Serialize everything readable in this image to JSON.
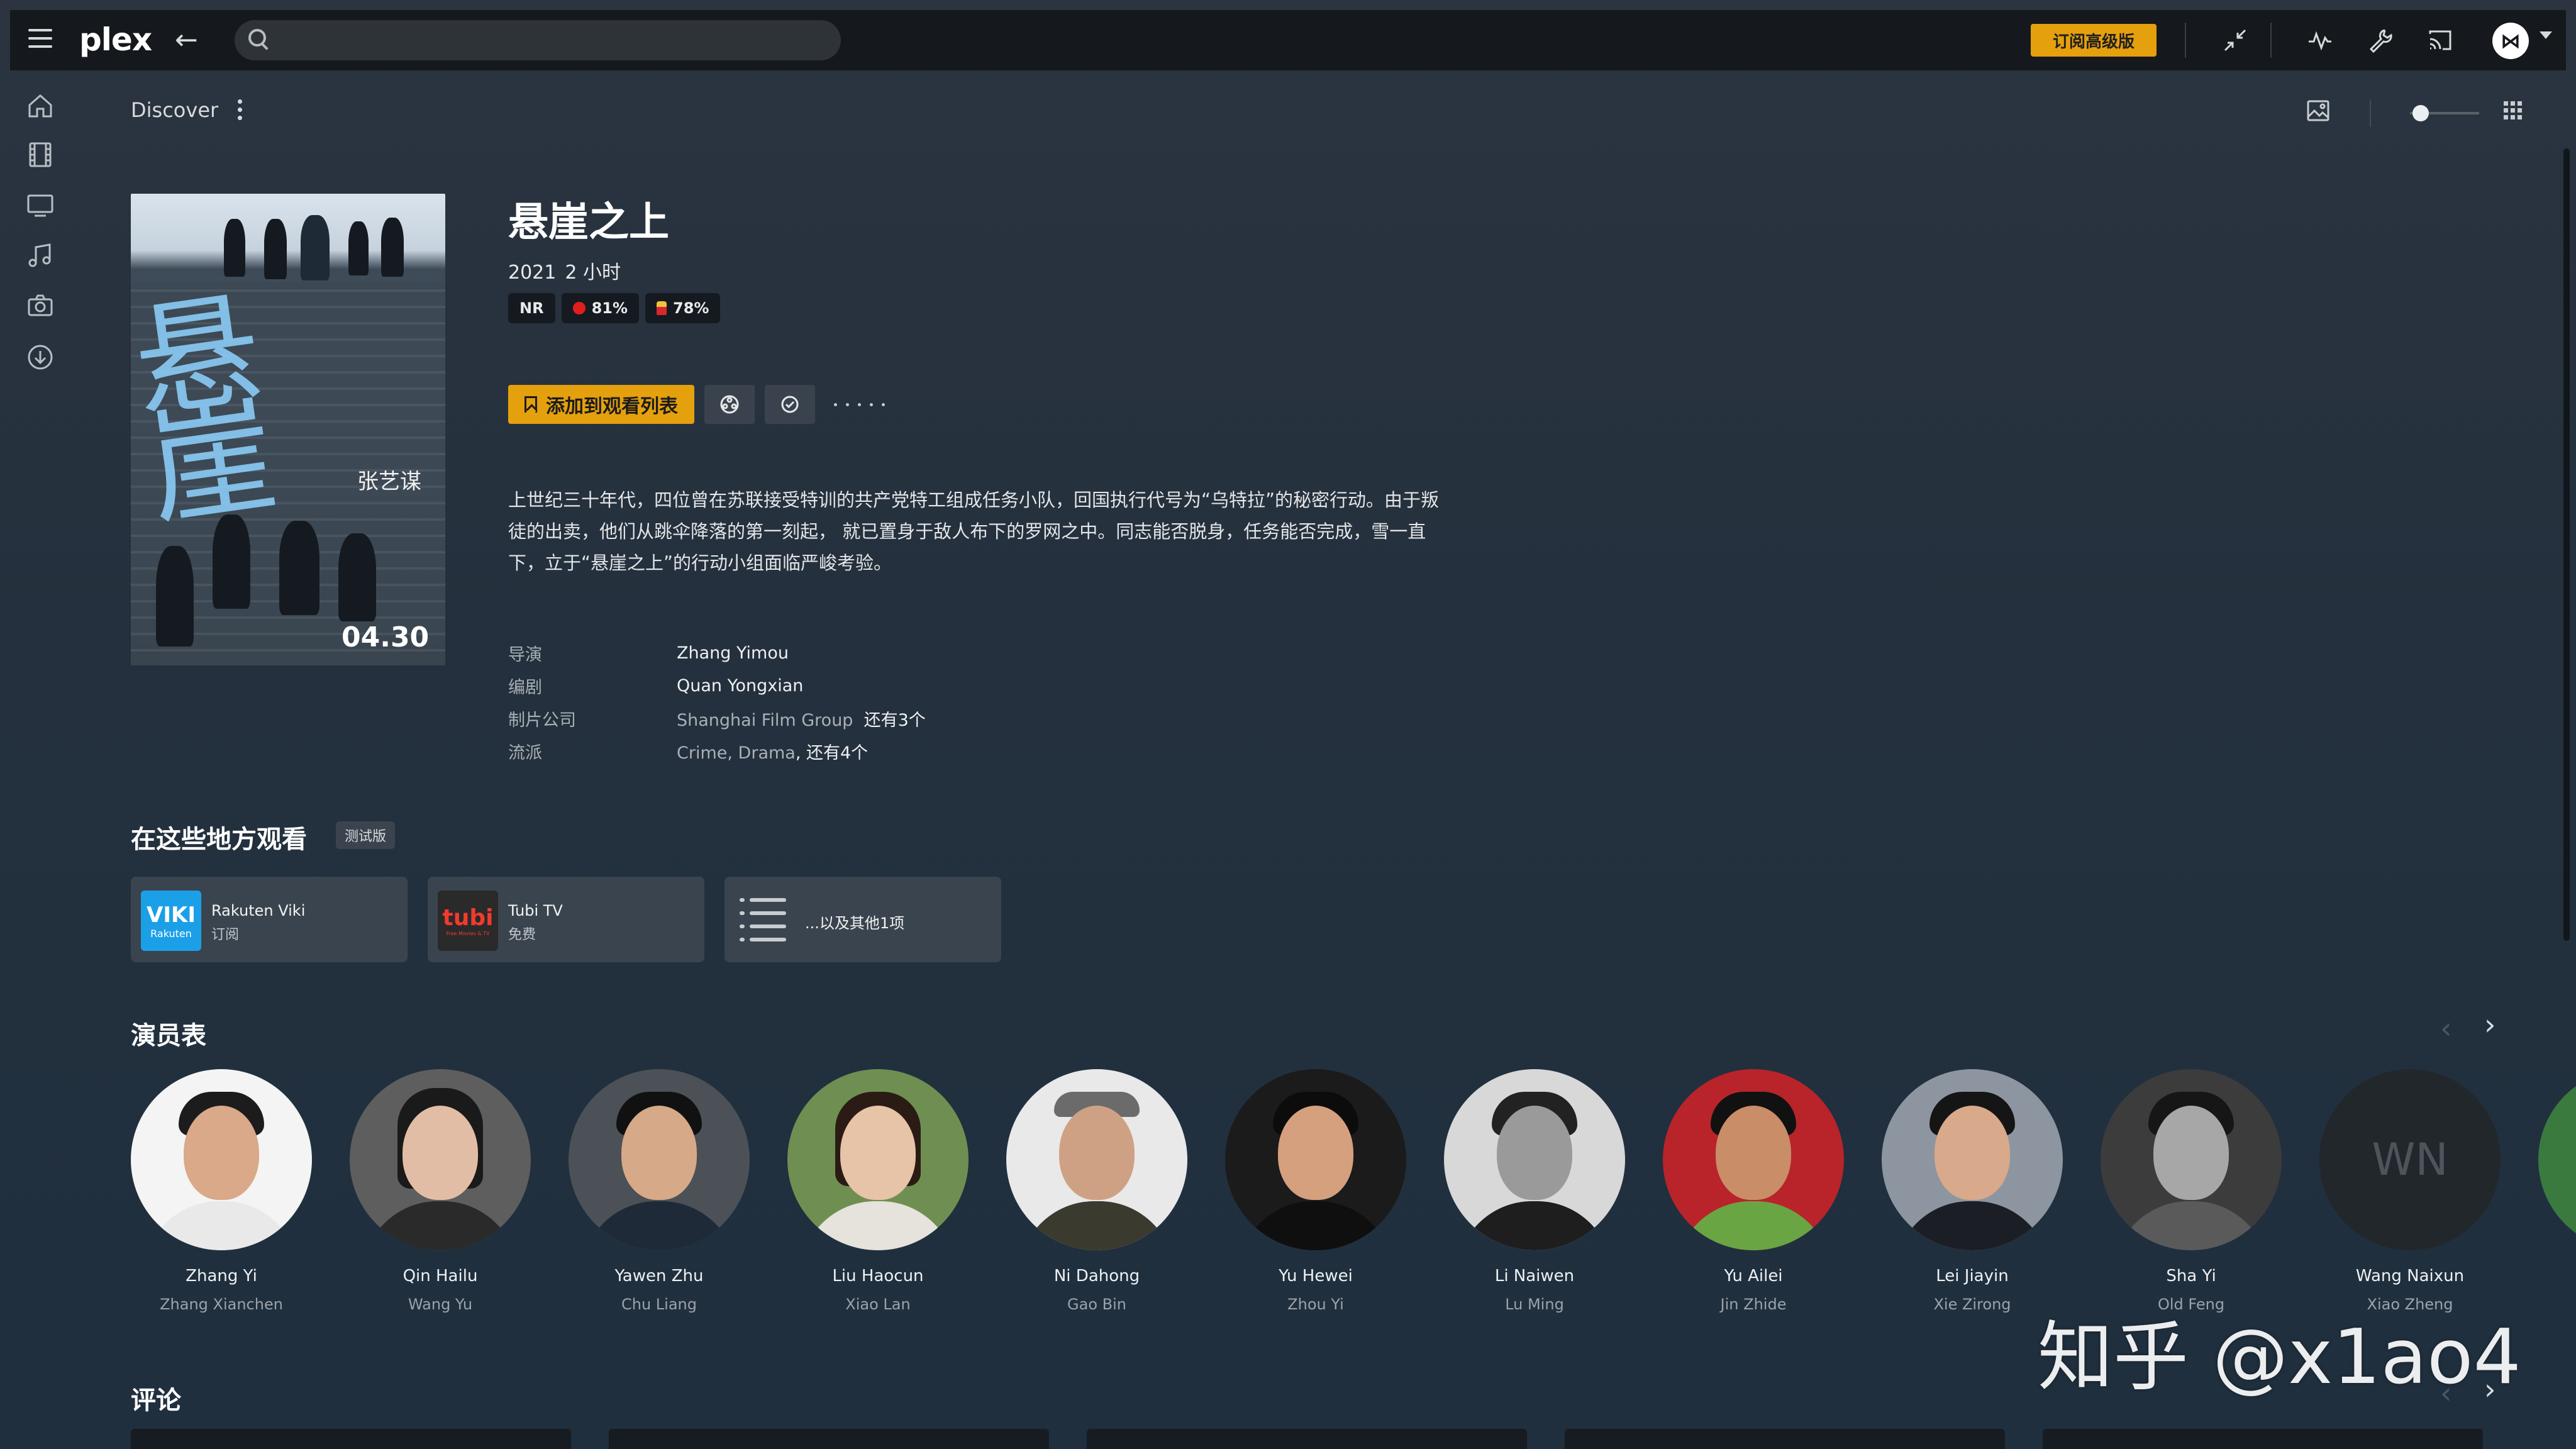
{
  "topbar": {
    "logo_text": "plex",
    "search_placeholder": "",
    "premium_label": "订阅高级版",
    "avatar_initial": "⋈"
  },
  "sidebar": {
    "items": [
      {
        "name": "home-icon"
      },
      {
        "name": "movies-icon"
      },
      {
        "name": "tv-icon"
      },
      {
        "name": "music-icon"
      },
      {
        "name": "photos-icon"
      },
      {
        "name": "downloads-icon"
      }
    ]
  },
  "header": {
    "breadcrumb": "Discover"
  },
  "movie": {
    "title": "悬崖之上",
    "year": "2021",
    "duration": "2 小时",
    "rating": "NR",
    "tomatometer": "81%",
    "audience_score": "78%",
    "watchlist_label": "添加到观看列表",
    "summary": "上世纪三十年代，四位曾在苏联接受特训的共产党特工组成任务小队，回国执行代号为“乌特拉”的秘密行动。由于叛徒的出卖，他们从跳伞降落的第一刻起， 就已置身于敌人布下的罗网之中。同志能否脱身，任务能否完成，雪一直下，立于“悬崖之上”的行动小组面临严峻考验。",
    "poster_director": "张艺谋",
    "poster_date": "04.30",
    "details": {
      "director_label": "导演",
      "director": "Zhang Yimou",
      "writer_label": "编剧",
      "writer": "Quan Yongxian",
      "studio_label": "制片公司",
      "studio": "Shanghai Film Group",
      "studio_more": "还有3个",
      "genre_label": "流派",
      "genre_1": "Crime",
      "genre_sep": ", ",
      "genre_2": "Drama",
      "genre_more": ", 还有4个"
    }
  },
  "where_to_watch": {
    "title": "在这些地方观看",
    "beta_label": "测试版",
    "providers": [
      {
        "name": "Rakuten Viki",
        "type": "订阅",
        "logo_top": "VIKI",
        "logo_bottom": "Rakuten",
        "color": "#1ba0e8"
      },
      {
        "name": "Tubi TV",
        "type": "免费",
        "logo_top": "tubi",
        "logo_bottom": "Free Movies & TV",
        "color": "#2a2a2a"
      }
    ],
    "more_label": "...以及其他1项"
  },
  "cast": {
    "title": "演员表",
    "members": [
      {
        "name": "Zhang Yi",
        "role": "Zhang Xianchen"
      },
      {
        "name": "Qin Hailu",
        "role": "Wang Yu"
      },
      {
        "name": "Yawen Zhu",
        "role": "Chu Liang"
      },
      {
        "name": "Liu Haocun",
        "role": "Xiao Lan"
      },
      {
        "name": "Ni Dahong",
        "role": "Gao Bin"
      },
      {
        "name": "Yu Hewei",
        "role": "Zhou Yi"
      },
      {
        "name": "Li Naiwen",
        "role": "Lu Ming"
      },
      {
        "name": "Yu Ailei",
        "role": "Jin Zhide"
      },
      {
        "name": "Lei Jiayin",
        "role": "Xie Zirong"
      },
      {
        "name": "Sha Yi",
        "role": "Old Feng"
      },
      {
        "name": "Wang Naixun",
        "role": "Xiao Zheng",
        "initials": "WN"
      }
    ]
  },
  "reviews": {
    "title": "评论"
  },
  "watermark": "知乎 @x1ao4",
  "colors": {
    "accent": "#e5a00d",
    "topbar": "#15191e",
    "background": "#27323e"
  }
}
